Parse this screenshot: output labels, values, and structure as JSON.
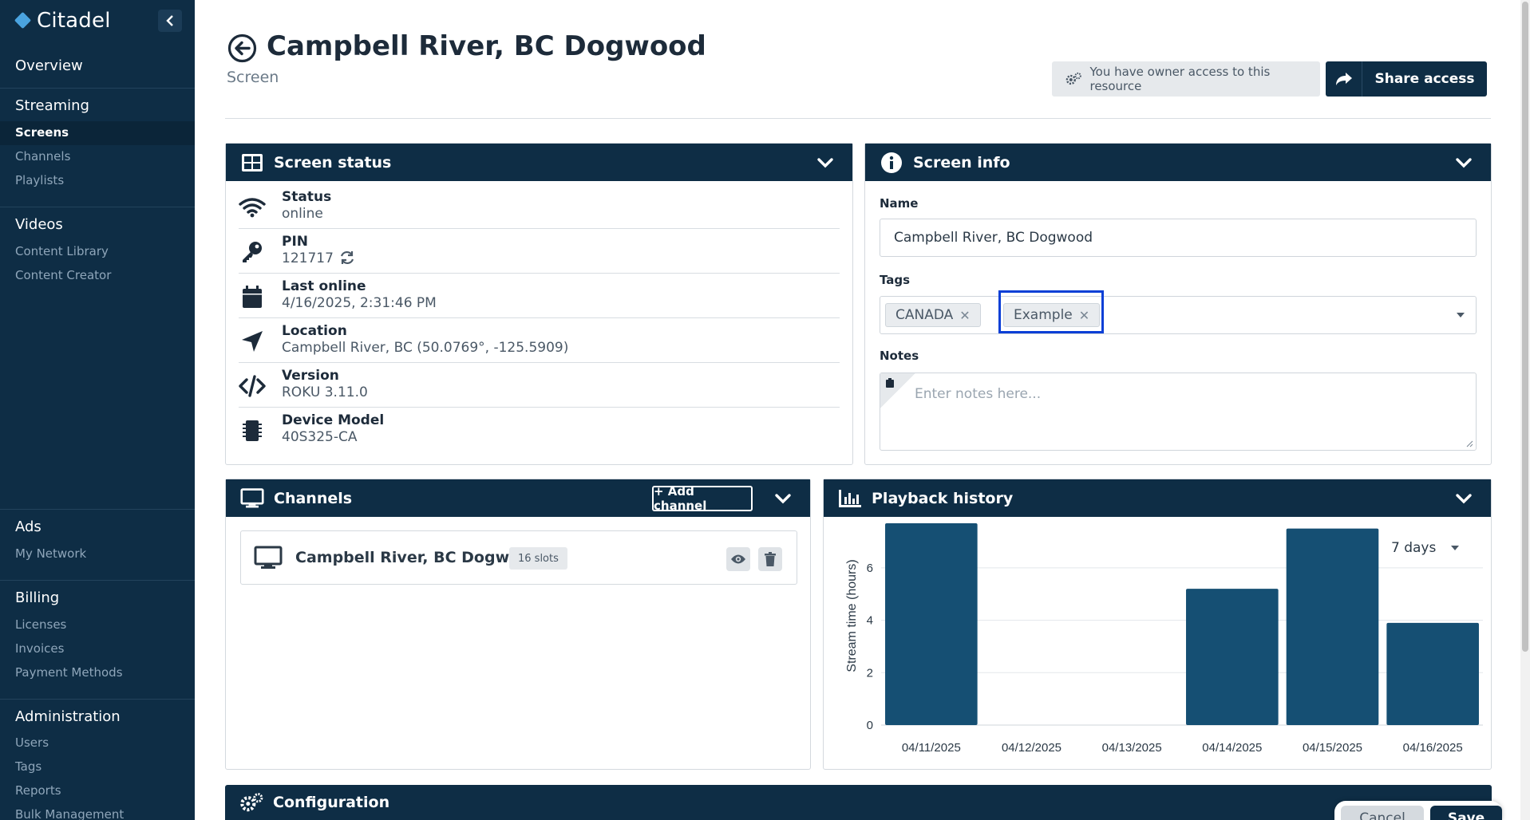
{
  "app": {
    "brand": "Citadel"
  },
  "sidebar": {
    "overview": "Overview",
    "sections": [
      {
        "title": "Streaming",
        "items": [
          "Screens",
          "Channels",
          "Playlists"
        ],
        "active": "Screens"
      },
      {
        "title": "Videos",
        "items": [
          "Content Library",
          "Content Creator"
        ]
      },
      {
        "title": "Ads",
        "items": [
          "My Network"
        ]
      },
      {
        "title": "Billing",
        "items": [
          "Licenses",
          "Invoices",
          "Payment Methods"
        ]
      },
      {
        "title": "Administration",
        "items": [
          "Users",
          "Tags",
          "Reports",
          "Bulk Management"
        ]
      }
    ]
  },
  "header": {
    "title": "Campbell River, BC Dogwood",
    "subtitle": "Screen",
    "owner_badge": "You have owner access to this resource",
    "share_label": "Share access"
  },
  "screen_status": {
    "title": "Screen status",
    "rows": [
      {
        "icon": "wifi-icon",
        "label": "Status",
        "value": "online"
      },
      {
        "icon": "key-icon",
        "label": "PIN",
        "value": "121717"
      },
      {
        "icon": "calendar-icon",
        "label": "Last online",
        "value": "4/16/2025, 2:31:46 PM"
      },
      {
        "icon": "location-arrow-icon",
        "label": "Location",
        "value": "Campbell River, BC (50.0769°, -125.5909)"
      },
      {
        "icon": "code-icon",
        "label": "Version",
        "value": "ROKU 3.11.0"
      },
      {
        "icon": "chip-icon",
        "label": "Device Model",
        "value": "40S325-CA"
      }
    ]
  },
  "screen_info": {
    "title": "Screen info",
    "name_label": "Name",
    "name_value": "Campbell River, BC Dogwood",
    "tags_label": "Tags",
    "tags": [
      "CANADA",
      "Example"
    ],
    "notes_label": "Notes",
    "notes_placeholder": "Enter notes here..."
  },
  "channels": {
    "title": "Channels",
    "add_label": "+ Add channel",
    "items": [
      {
        "name": "Campbell River, BC Dogwood",
        "slots": "16 slots"
      }
    ]
  },
  "playback": {
    "title": "Playback history",
    "range": "7 days"
  },
  "chart_data": {
    "type": "bar",
    "categories": [
      "04/11/2025",
      "04/12/2025",
      "04/13/2025",
      "04/14/2025",
      "04/15/2025",
      "04/16/2025"
    ],
    "values": [
      7.7,
      0,
      0,
      5.2,
      7.5,
      3.9
    ],
    "xlabel": "",
    "ylabel": "Stream time (hours)",
    "ylim": [
      0,
      7.7
    ],
    "yticks": [
      0,
      2,
      4,
      6
    ],
    "grid": true,
    "color": "#154f73"
  },
  "configuration": {
    "title": "Configuration"
  },
  "footer": {
    "cancel_label": "Cancel",
    "save_label": "Save"
  },
  "colors": {
    "navy": "#0e2d45",
    "accent": "#4aa3df",
    "bar": "#154f73",
    "highlight": "#0a3fd6"
  }
}
